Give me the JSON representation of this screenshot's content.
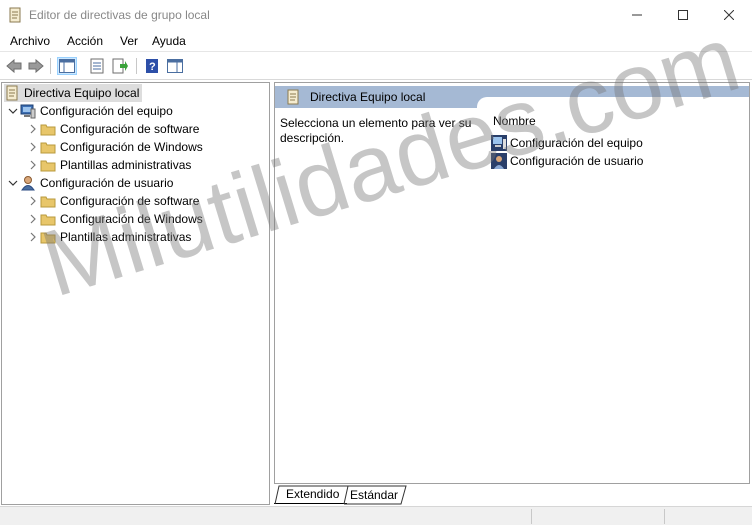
{
  "window": {
    "title": "Editor de directivas de grupo local"
  },
  "menu": {
    "items": [
      "Archivo",
      "Acción",
      "Ver",
      "Ayuda"
    ]
  },
  "toolbar": {
    "buttons": [
      "back-arrow-icon",
      "forward-arrow-icon",
      "show-hide-console-tree-icon",
      "properties-icon",
      "export-list-icon",
      "help-icon",
      "action-pane-icon"
    ]
  },
  "tree": {
    "root": "Directiva Equipo local",
    "computer": {
      "label": "Configuración del equipo",
      "children": [
        "Configuración de software",
        "Configuración de Windows",
        "Plantillas administrativas"
      ]
    },
    "user": {
      "label": "Configuración de usuario",
      "children": [
        "Configuración de software",
        "Configuración de Windows",
        "Plantillas administrativas"
      ]
    }
  },
  "details": {
    "header": "Directiva Equipo local",
    "description": "Selecciona un elemento para ver su descripción.",
    "column": "Nombre",
    "items": [
      "Configuración del equipo",
      "Configuración de usuario"
    ]
  },
  "tabs": {
    "extended": "Extendido",
    "standard": "Estándar"
  },
  "watermark": "Milutilidades.com",
  "colors": {
    "header_bar": "#a5b9d4",
    "selection": "#dddddd",
    "folder": "#e8c66a"
  }
}
